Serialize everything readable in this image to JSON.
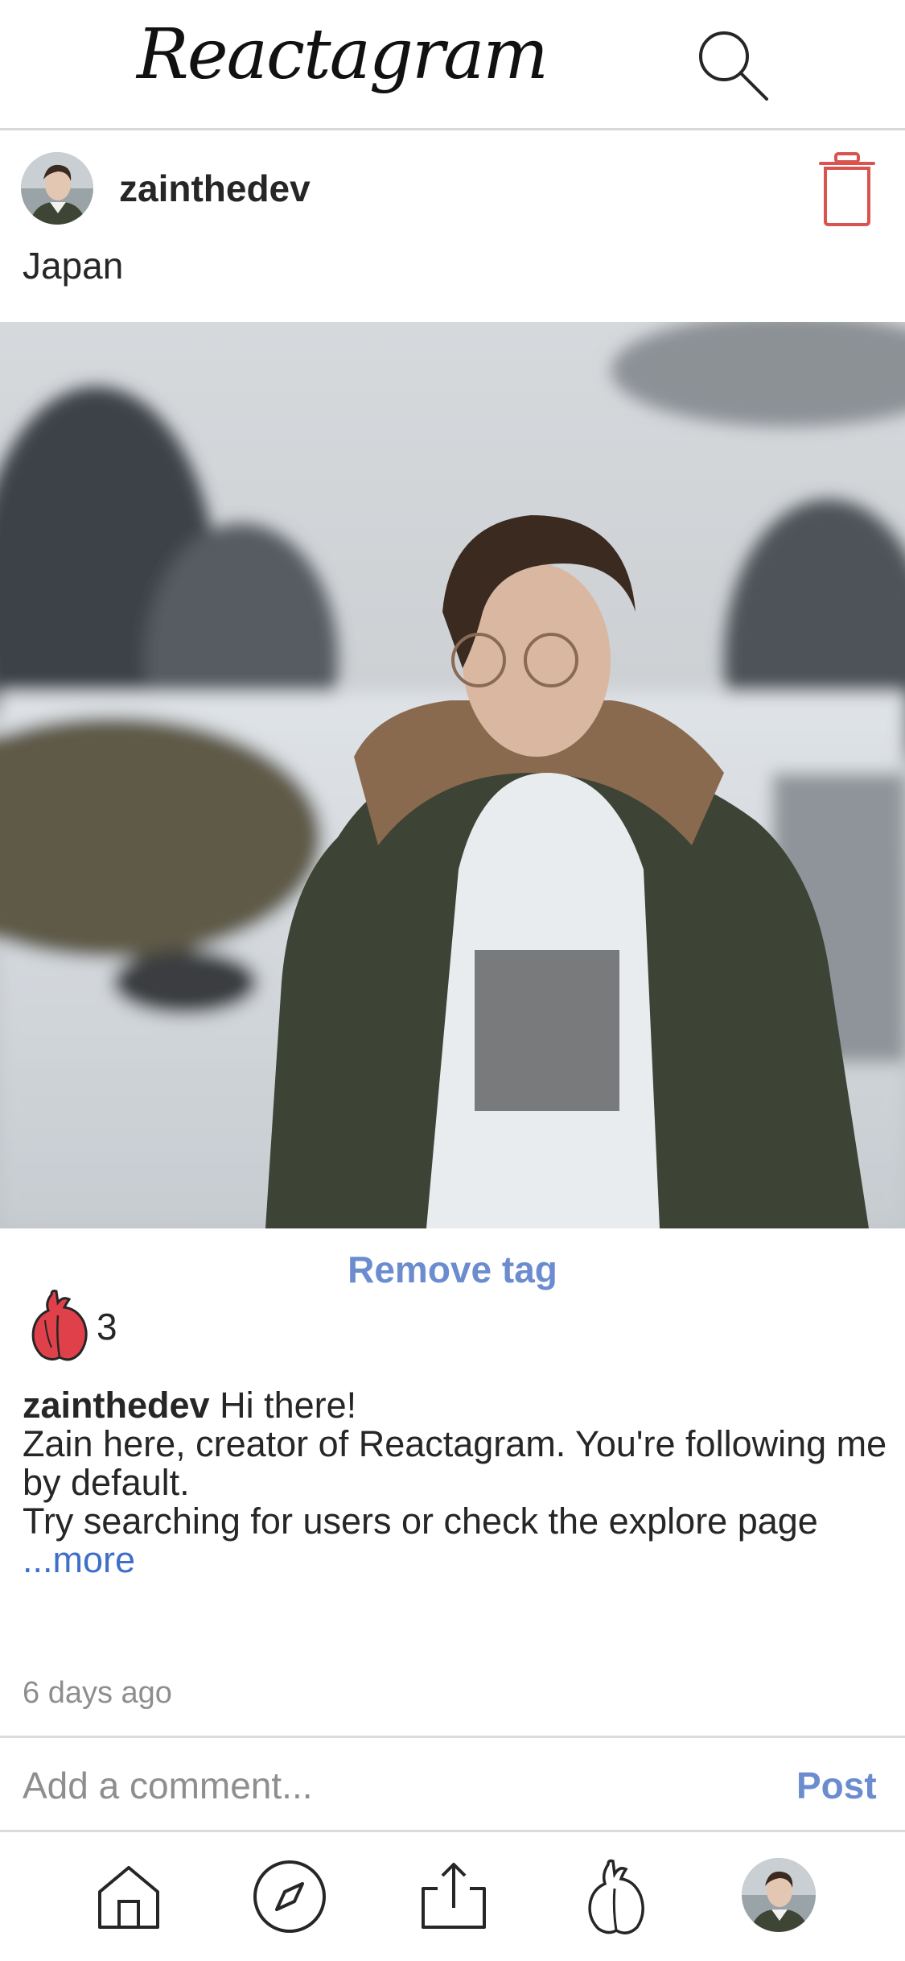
{
  "app": {
    "title": "Reactagram"
  },
  "header": {
    "logo_text": "Reactagram",
    "search_icon": "search-icon"
  },
  "post": {
    "username": "zainthedev",
    "location": "Japan",
    "remove_tag_label": "Remove tag",
    "like_count": "3",
    "caption": {
      "username": "zainthedev",
      "line1": "Hi there!",
      "line2": "Zain here, creator of Reactagram. You're following me by default.",
      "line3": "Try searching for users or check the explore page",
      "more_label": "...more"
    },
    "timestamp": "6 days ago"
  },
  "comment": {
    "placeholder": "Add a comment...",
    "post_label": "Post"
  },
  "nav": {
    "items": [
      "home-icon",
      "explore-compass-icon",
      "upload-icon",
      "activity-heart-icon",
      "profile-avatar"
    ]
  },
  "colors": {
    "accent": "#6b8ccf",
    "like_red": "#e0404a",
    "trash_red": "#d9534f",
    "link_blue": "#3f6fc9"
  }
}
